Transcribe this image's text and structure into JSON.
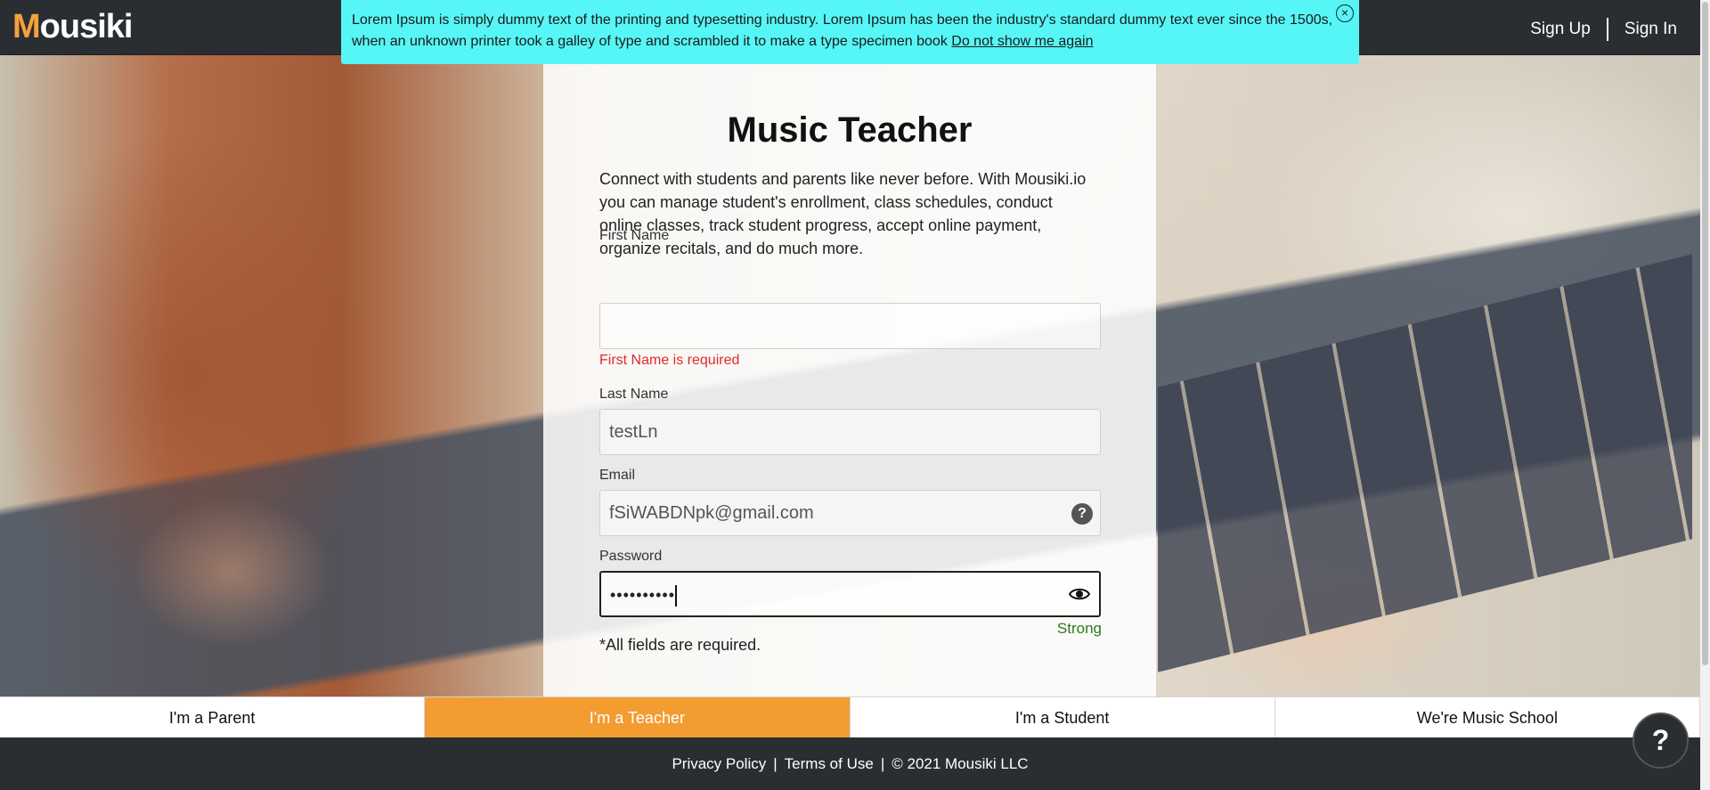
{
  "header": {
    "logo_text": "Mousiki",
    "sign_up": "Sign Up",
    "sign_in": "Sign In"
  },
  "banner": {
    "text": "Lorem Ipsum is simply dummy text of the printing and typesetting industry. Lorem Ipsum has been the industry's standard dummy text ever since the 1500s, when an unknown printer took a galley of type and scrambled it to make a type specimen book",
    "dismiss_label": "Do not show me again",
    "close_icon": "close-icon"
  },
  "form": {
    "title": "Music Teacher",
    "intro": "Connect with students and parents like never before. With Mousiki.io you can manage student's enrollment, class schedules, conduct online classes, track student progress, accept online payment, organize recitals, and do much more.",
    "first_name": {
      "label": "First Name",
      "value": "",
      "error": "First Name is required"
    },
    "last_name": {
      "label": "Last Name",
      "value": "testLn"
    },
    "email": {
      "label": "Email",
      "value": "fSiWABDNpk@gmail.com",
      "help_icon": "?"
    },
    "password": {
      "label": "Password",
      "value": "••••••••••",
      "strength": "Strong"
    },
    "required_note": "*All fields are required."
  },
  "tabs": [
    {
      "label": "I'm a Parent",
      "active": false
    },
    {
      "label": "I'm a Teacher",
      "active": true
    },
    {
      "label": "I'm a Student",
      "active": false
    },
    {
      "label": "We're Music School",
      "active": false
    }
  ],
  "footer": {
    "privacy": "Privacy Policy",
    "sep": "|",
    "terms": "Terms of Use",
    "copyright": "© 2021 Mousiki LLC"
  },
  "help_button": {
    "label": "?"
  },
  "colors": {
    "accent": "#f39c32",
    "banner": "#57f6f6",
    "error": "#e12929",
    "strength": "#2d7a1e",
    "header_bg": "#2a2d31"
  }
}
